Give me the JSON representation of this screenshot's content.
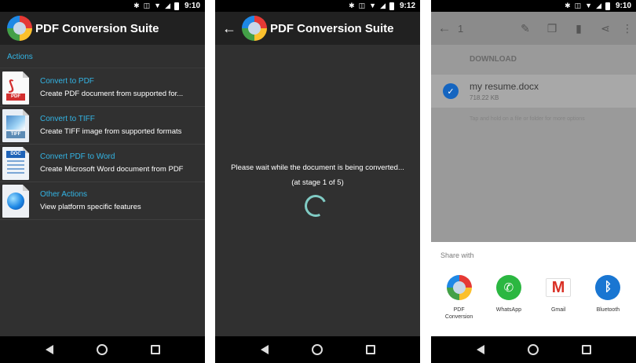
{
  "status_bar": {
    "time_1": "9:10",
    "time_2": "9:12",
    "time_3": "9:10"
  },
  "app": {
    "title": "PDF Conversion Suite"
  },
  "actions_screen": {
    "section_header": "Actions",
    "items": [
      {
        "title": "Convert to PDF",
        "description": "Create PDF document from supported for...",
        "icon": "pdf-file-icon",
        "badge": "PDF"
      },
      {
        "title": "Convert to TIFF",
        "description": "Create TIFF image from supported formats",
        "icon": "tiff-file-icon",
        "badge": "TIFF"
      },
      {
        "title": "Convert PDF to Word",
        "description": "Create Microsoft Word document from PDF",
        "icon": "doc-file-icon",
        "badge": "DOC"
      },
      {
        "title": "Other Actions",
        "description": "View platform specific features",
        "icon": "globe-icon",
        "badge": ""
      }
    ]
  },
  "progress_screen": {
    "message": "Please wait while the document is being converted...",
    "stage": "(at stage 1 of 5)"
  },
  "share_screen": {
    "toolbar": {
      "count": "1"
    },
    "download_label": "DOWNLOAD",
    "file": {
      "name": "my resume.docx",
      "size": "718.22 KB"
    },
    "hint": "Tap and hold on a file or folder for more options",
    "share_title": "Share with",
    "targets": [
      {
        "label": "PDF Conversion",
        "icon": "pdf-conversion-app-icon"
      },
      {
        "label": "WhatsApp",
        "icon": "whatsapp-icon"
      },
      {
        "label": "Gmail",
        "icon": "gmail-icon"
      },
      {
        "label": "Bluetooth",
        "icon": "bluetooth-icon"
      }
    ]
  },
  "colors": {
    "accent": "#33b5e5",
    "appbar": "#212121",
    "background": "#303030",
    "spinner": "#80cbc4",
    "check": "#1565c0"
  }
}
